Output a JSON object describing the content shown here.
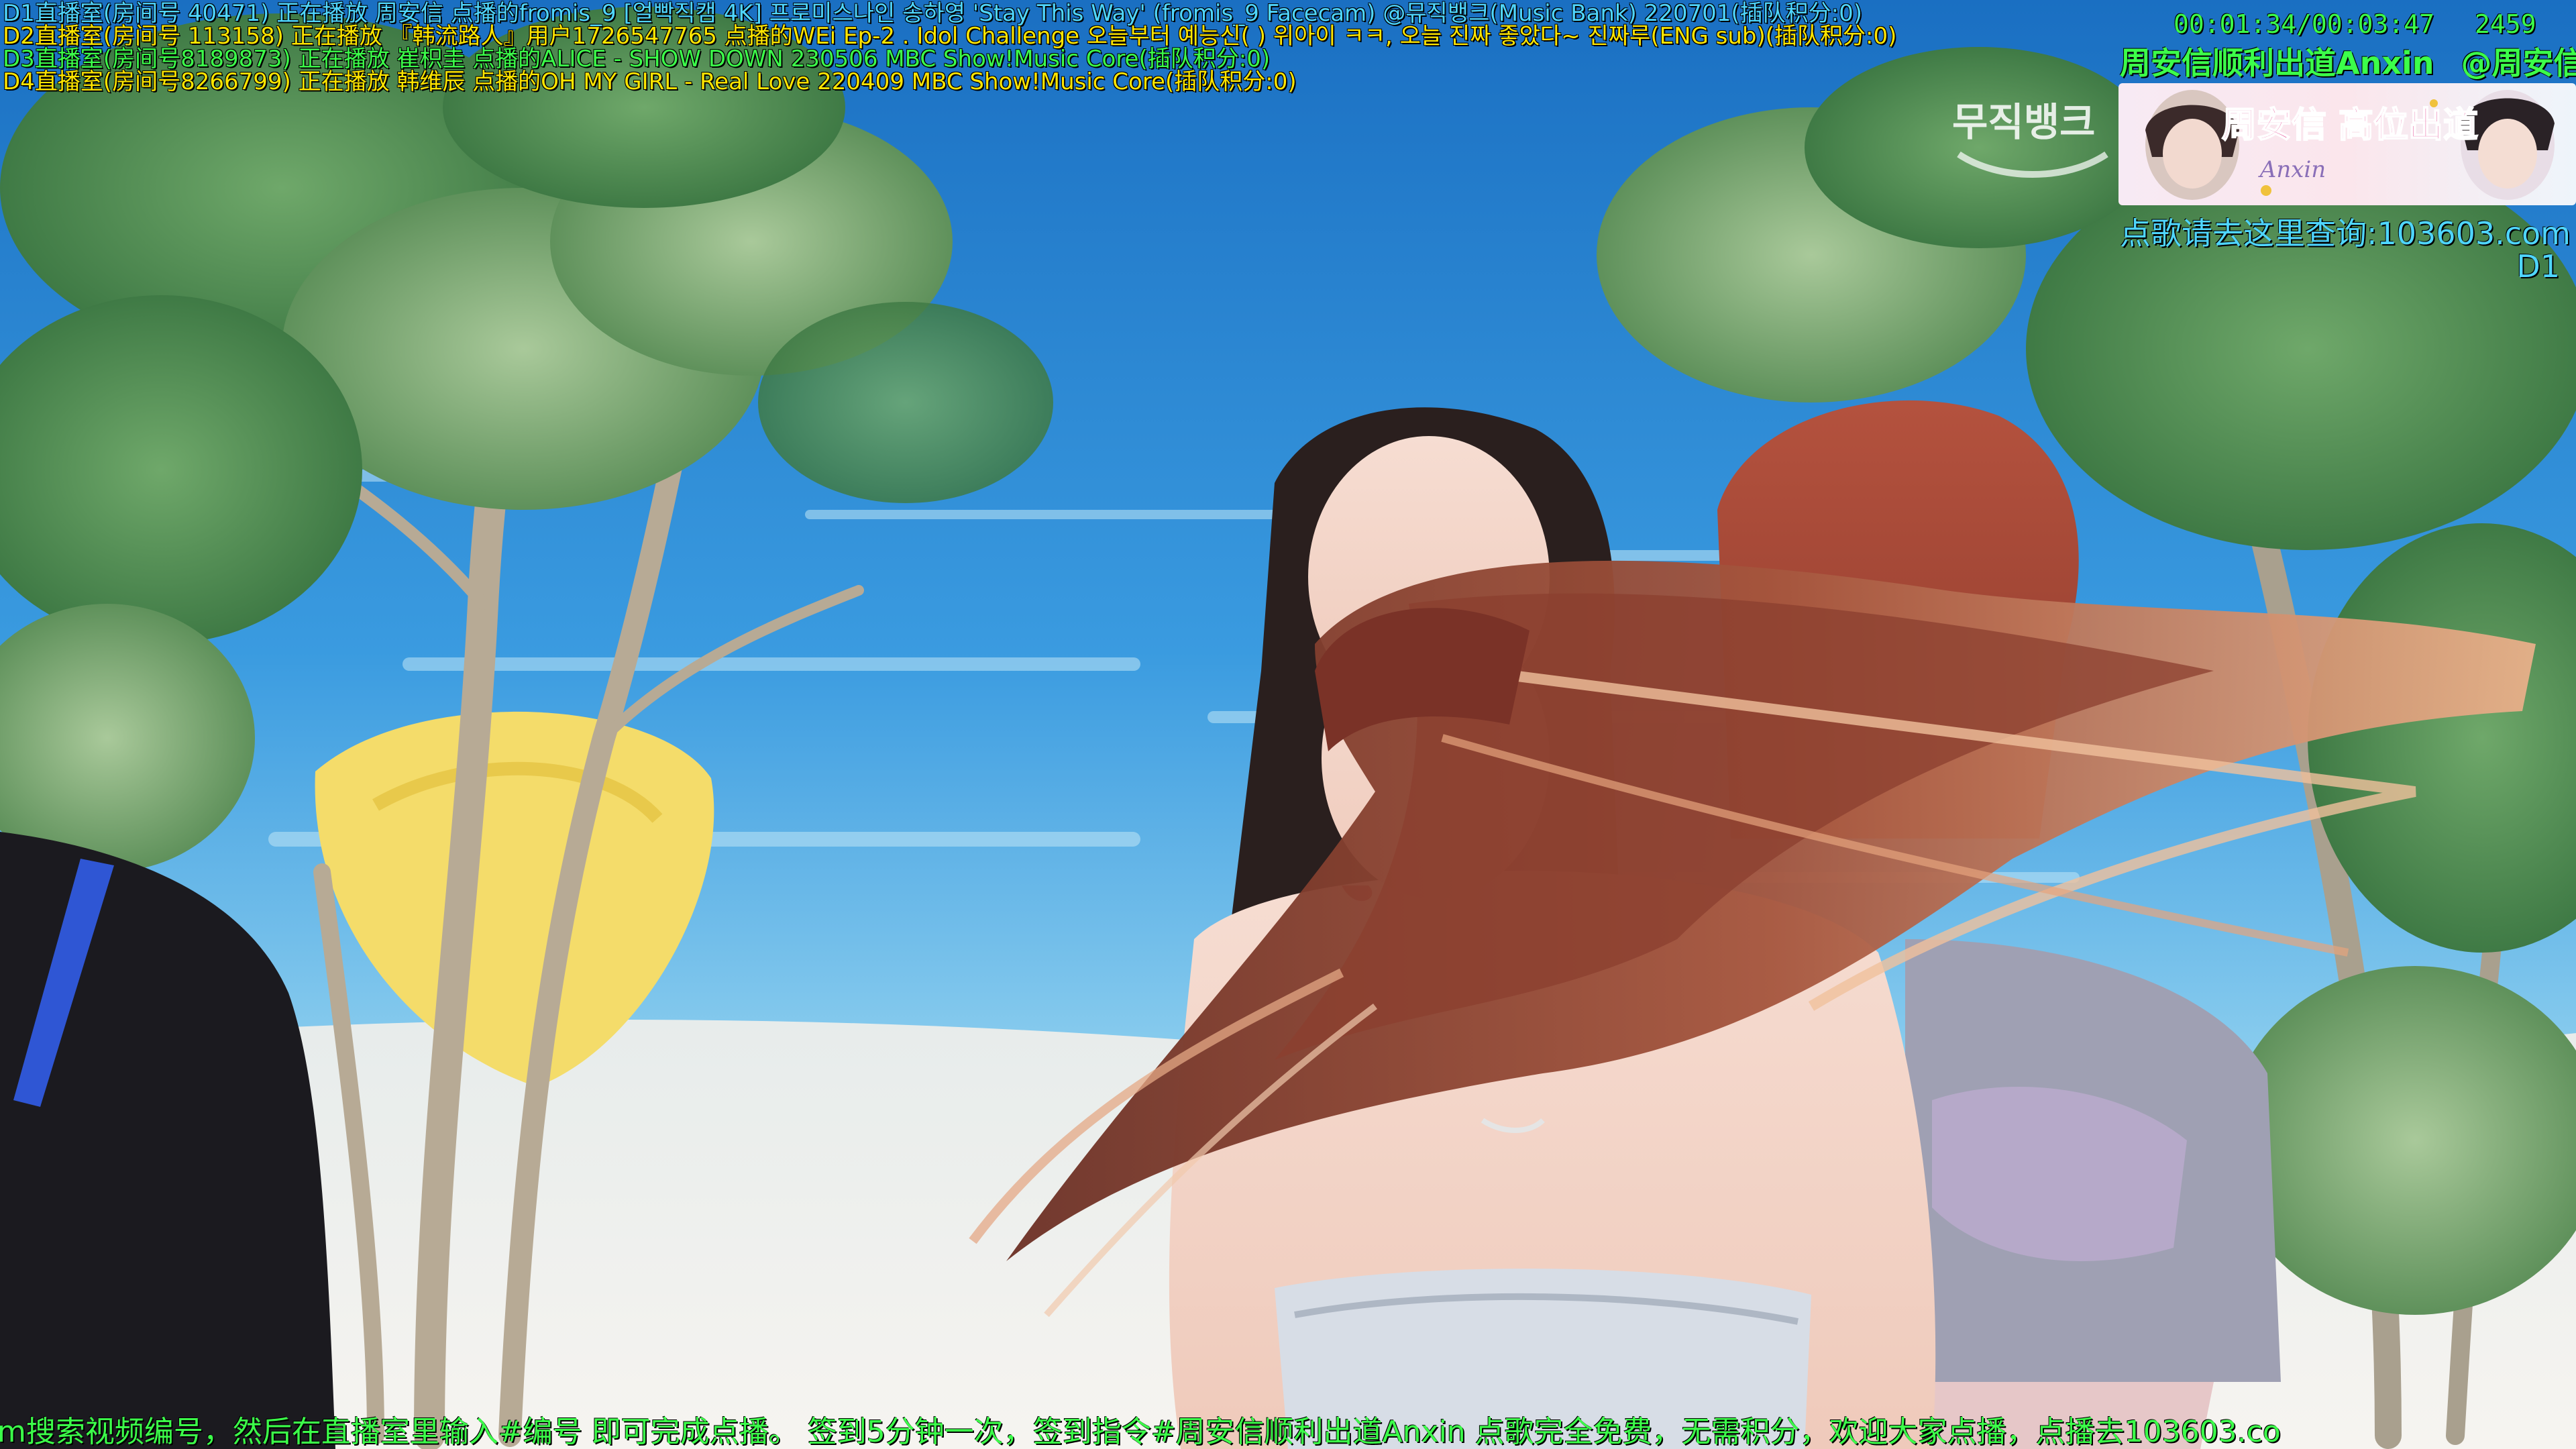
{
  "playlist": {
    "d1": "D1直播室(房间号   40471) 正在播放 周安信 点播的fromis_9 [얼빡직캠 4K] 프로미스나인 송하영 'Stay This Way' (fromis_9 Facecam) @뮤직뱅크(Music Bank) 220701(插队积分:0)",
    "d2": "D2直播室(房间号  113158) 正在播放 『韩流路人』用户1726547765 点播的WEi Ep-2 . Idol Challenge 오늘부터 예능신(  ) 위아이 ㅋㅋ, 오늘 진짜 좋았다~ 진짜루(ENG sub)(插队积分:0)",
    "d3": "D3直播室(房间号8189873) 正在播放 崔枳圭 点播的ALICE - SHOW DOWN 230506 MBC Show!Music Core(插队积分:0)",
    "d4": "D4直播室(房间号8266799) 正在播放 韩维辰 点播的OH MY GIRL - Real Love 220409 MBC Show!Music Core(插队积分:0)"
  },
  "player": {
    "elapsed": "00:01:34",
    "duration": "00:03:47",
    "separator": "/",
    "viewer_count": "2459"
  },
  "streamer": {
    "cheer_text": "周安信顺利出道Anxin",
    "handle": "@周安信",
    "banner_text": "周安信 高位出道",
    "banner_sub": "Anxin"
  },
  "info": {
    "query_text": "点歌请去这里查询:103603.com",
    "room_tag": "D1"
  },
  "ticker": {
    "text": "m搜索视频编号，然后在直播室里输入#编号 即可完成点播。  签到5分钟一次，签到指令#周安信顺利出道Anxin  点歌完全免费，无需积分，欢迎大家点播，点播去103603.co"
  },
  "program_logo": "무직뱅크",
  "colors": {
    "cyan": "#4fd6ff",
    "yellow": "#ffe600",
    "green": "#3cff4a",
    "sea": "#2c8fd8",
    "sand": "#f2f1ee"
  }
}
